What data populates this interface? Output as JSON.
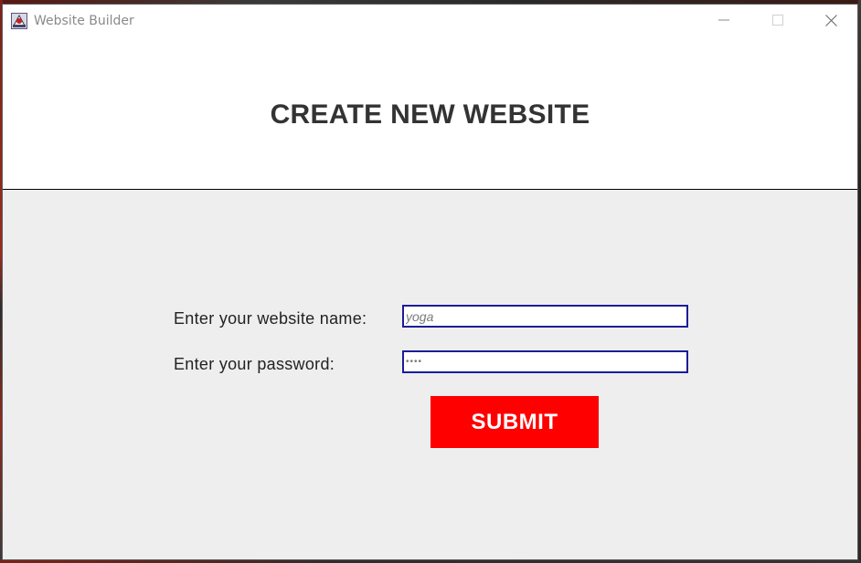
{
  "window": {
    "title": "Website Builder",
    "icon": "java-app-icon",
    "controls": [
      "minimize-icon",
      "maximize-icon",
      "close-icon"
    ]
  },
  "header": {
    "title": "CREATE NEW WEBSITE"
  },
  "form": {
    "website_name_label": "Enter your website name:",
    "website_name_value": "yoga",
    "password_label": "Enter your password:",
    "password_value": "••••",
    "submit_label": "SUBMIT"
  },
  "colors": {
    "submit_background": "#ff0000",
    "submit_text": "#ffffff",
    "field_border": "#1c1c9c",
    "content_background": "#eeeeee",
    "heading_text": "#333333"
  }
}
